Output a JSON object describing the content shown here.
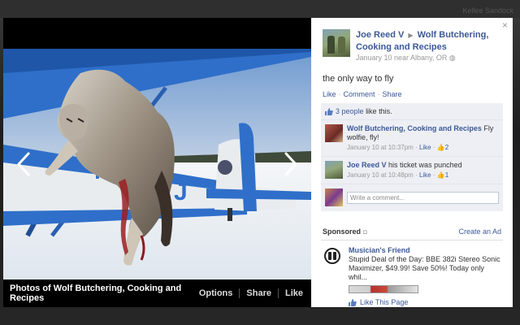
{
  "background": {
    "top_right_text": "Kellee Sandock"
  },
  "stage": {
    "album_title": "Photos of Wolf Butchering, Cooking and Recipes",
    "actions": [
      "Options",
      "Share",
      "Like"
    ],
    "photo_text": "N3",
    "photo_text_2": "J"
  },
  "panel": {
    "close_label": "×",
    "poster_name": "Joe Reed V",
    "poster_target": "Wolf Butchering, Cooking and Recipes",
    "poster_meta": "January 10 near Albany, OR",
    "caption": "the only way to fly",
    "actions": [
      "Like",
      "Comment",
      "Share"
    ],
    "likes_count_text": "3 people",
    "likes_suffix": "like this.",
    "comments": [
      {
        "author": "Wolf Butchering, Cooking and Recipes",
        "text": "Fly wolfie, fly!",
        "time": "January 10 at 10:37pm",
        "like_label": "Like",
        "like_count": "2"
      },
      {
        "author": "Joe Reed V",
        "text": "his ticket was punched",
        "time": "January 10 at 10:48pm",
        "like_label": "Like",
        "like_count": "1"
      }
    ],
    "comment_placeholder": "Write a comment..."
  },
  "sponsored": {
    "title": "Sponsored",
    "create_ad": "Create an Ad",
    "ad_name": "Musician's Friend",
    "ad_text": "Stupid Deal of the Day: BBE 382i Stereo Sonic Maximizer, $49.99! Save 50%! Today only whil...",
    "like_page": "Like This Page"
  }
}
